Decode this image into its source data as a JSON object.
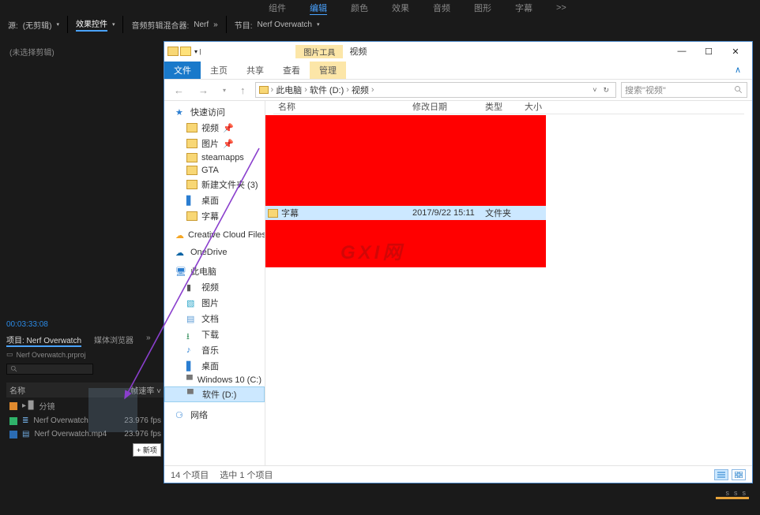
{
  "topmenu": {
    "items": [
      "组件",
      "编辑",
      "颜色",
      "效果",
      "音频",
      "图形",
      "字幕"
    ],
    "active_index": 1,
    "extra": ">>"
  },
  "tabbar": {
    "g1": {
      "label": "源:",
      "value": "(无剪辑)"
    },
    "g2": {
      "label": "效果控件"
    },
    "g3": {
      "label": "音频剪辑混合器:",
      "value": "Nerf"
    },
    "g4": {
      "label": "节目:",
      "value": "Nerf Overwatch"
    }
  },
  "source_placeholder": "(未选择剪辑)",
  "timecode": "00:03:33:08",
  "project": {
    "tab_label": "项目: Nerf Overwatch",
    "tab2": "媒体浏览器",
    "filename": "Nerf Overwatch.prproj",
    "name_col": "名称",
    "rate_col": "帧速率",
    "bin_name": "分镜",
    "item1": "Nerf Overwatch",
    "item2": "Nerf Overwatch.mp4",
    "fps": "23.976 fps",
    "newbin_btn": "+ 新项"
  },
  "explorer": {
    "toolcap": "图片工具",
    "title": "视频",
    "ribbon": {
      "file": "文件",
      "home": "主页",
      "share": "共享",
      "view": "查看",
      "manage": "管理",
      "arrow": "∧"
    },
    "nav": {
      "pc": "此电脑",
      "d": "软件 (D:)",
      "folder": "视频",
      "refresh": "↻",
      "dropdown": "˅"
    },
    "search_placeholder": "搜索\"视频\"",
    "columns": {
      "name": "名称",
      "date": "修改日期",
      "type": "类型",
      "size": "大小"
    },
    "selrow": {
      "name": "字幕",
      "date": "2017/9/22 15:11",
      "type": "文件夹"
    },
    "watermark": "GXI网",
    "tree": {
      "quick": "快速访问",
      "videos": "视频",
      "pictures": "图片",
      "steamapps": "steamapps",
      "gta": "GTA",
      "newfolder": "新建文件夹 (3)",
      "desktop": "桌面",
      "subtitles": "字幕",
      "ccf": "Creative Cloud Files",
      "onedrive": "OneDrive",
      "thispc": "此电脑",
      "tp_video": "视频",
      "tp_pictures": "图片",
      "tp_docs": "文档",
      "tp_dl": "下载",
      "tp_music": "音乐",
      "tp_desktop": "桌面",
      "tp_c": "Windows 10 (C:)",
      "tp_d": "软件 (D:)",
      "network": "网络"
    },
    "status": {
      "count": "14 个项目",
      "selected": "选中 1 个项目"
    }
  }
}
